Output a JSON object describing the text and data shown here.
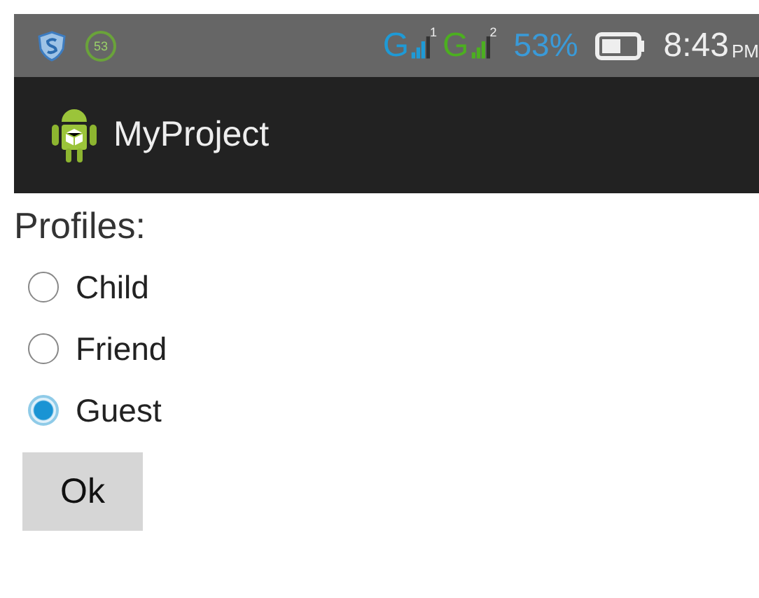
{
  "status_bar": {
    "badge": "53",
    "sims": [
      {
        "network": "G",
        "slot": "1",
        "color": "#1e9ad6"
      },
      {
        "network": "G",
        "slot": "2",
        "color": "#4caf20"
      }
    ],
    "battery": "53%",
    "time": "8:43",
    "ampm": "PM"
  },
  "action_bar": {
    "title": "MyProject"
  },
  "profiles": {
    "label": "Profiles:",
    "options": [
      {
        "label": "Child",
        "selected": false
      },
      {
        "label": "Friend",
        "selected": false
      },
      {
        "label": "Guest",
        "selected": true
      }
    ]
  },
  "buttons": [
    "Ok"
  ]
}
